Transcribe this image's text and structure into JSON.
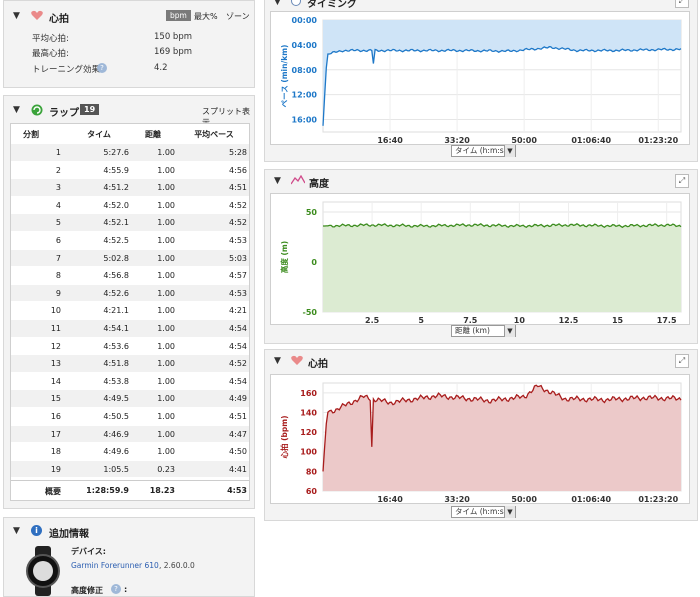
{
  "heart_rate_panel": {
    "title": "心拍",
    "tabs": [
      "bpm",
      "最大%",
      "ゾーン"
    ],
    "rows": [
      {
        "label": "平均心拍:",
        "value": "150 bpm"
      },
      {
        "label": "最高心拍:",
        "value": "169 bpm"
      },
      {
        "label": "トレーニング効果",
        "value": "4.2"
      }
    ]
  },
  "laps_panel": {
    "title": "ラップ",
    "count": "19",
    "split_link": "スプリット表示",
    "headers": [
      "分割",
      "タイム",
      "距離",
      "平均ペース"
    ],
    "rows": [
      [
        "1",
        "5:27.6",
        "1.00",
        "5:28"
      ],
      [
        "2",
        "4:55.9",
        "1.00",
        "4:56"
      ],
      [
        "3",
        "4:51.2",
        "1.00",
        "4:51"
      ],
      [
        "4",
        "4:52.0",
        "1.00",
        "4:52"
      ],
      [
        "5",
        "4:52.1",
        "1.00",
        "4:52"
      ],
      [
        "6",
        "4:52.5",
        "1.00",
        "4:53"
      ],
      [
        "7",
        "5:02.8",
        "1.00",
        "5:03"
      ],
      [
        "8",
        "4:56.8",
        "1.00",
        "4:57"
      ],
      [
        "9",
        "4:52.6",
        "1.00",
        "4:53"
      ],
      [
        "10",
        "4:21.1",
        "1.00",
        "4:21"
      ],
      [
        "11",
        "4:54.1",
        "1.00",
        "4:54"
      ],
      [
        "12",
        "4:53.6",
        "1.00",
        "4:54"
      ],
      [
        "13",
        "4:51.8",
        "1.00",
        "4:52"
      ],
      [
        "14",
        "4:53.8",
        "1.00",
        "4:54"
      ],
      [
        "15",
        "4:49.5",
        "1.00",
        "4:49"
      ],
      [
        "16",
        "4:50.5",
        "1.00",
        "4:51"
      ],
      [
        "17",
        "4:46.9",
        "1.00",
        "4:47"
      ],
      [
        "18",
        "4:49.6",
        "1.00",
        "4:50"
      ],
      [
        "19",
        "1:05.5",
        "0.23",
        "4:41"
      ]
    ],
    "summary": [
      "概要",
      "1:28:59.9",
      "18.23",
      "4:53"
    ]
  },
  "extra_info_panel": {
    "title": "追加情報",
    "device_label": "デバイス:",
    "device_link": "Garmin Forerunner 610",
    "device_version": ", 2.60.0.0",
    "elevation_label": "高度修正"
  },
  "charts": {
    "pace": {
      "title": "タイミング",
      "ylabel": "ペース (min/km)",
      "yticks": [
        "00:00",
        "04:00",
        "08:00",
        "12:00",
        "16:00"
      ],
      "xticks": [
        "16:40",
        "33:20",
        "50:00",
        "01:06:40",
        "01:23:20"
      ],
      "selector": "タイム (h:m:s)"
    },
    "elevation": {
      "title": "高度",
      "ylabel": "高度 (m)",
      "yticks": [
        "50",
        "0",
        "-50"
      ],
      "xticks": [
        "2.5",
        "5",
        "7.5",
        "10",
        "12.5",
        "15",
        "17.5"
      ],
      "selector": "距離 (km)"
    },
    "heart": {
      "title": "心拍",
      "ylabel": "心拍 (bpm)",
      "yticks": [
        "160",
        "140",
        "120",
        "100",
        "80",
        "60"
      ],
      "xticks": [
        "16:40",
        "33:20",
        "50:00",
        "01:06:40",
        "01:23:20"
      ],
      "selector": "タイム (h:m:s)"
    }
  },
  "chart_data": [
    {
      "type": "area",
      "title": "タイミング",
      "ylabel": "ペース (min/km)",
      "x_unit": "seconds",
      "ylim_minutes": [
        0,
        18
      ],
      "y_inverted": true,
      "x": [
        0,
        60,
        300,
        700,
        1200,
        2000,
        2800,
        3400,
        3800,
        4300,
        4800,
        5339
      ],
      "values_minutes": [
        17.0,
        5.5,
        4.9,
        4.9,
        4.9,
        4.9,
        5.0,
        4.4,
        4.9,
        4.9,
        4.8,
        4.7
      ]
    },
    {
      "type": "area",
      "title": "高度",
      "ylabel": "高度 (m)",
      "ylim": [
        -50,
        60
      ],
      "x": [
        0,
        2.5,
        5,
        7.5,
        10,
        12.5,
        15,
        17.5,
        18.23
      ],
      "values": [
        36,
        37,
        36,
        37,
        36,
        37,
        36,
        37,
        36
      ]
    },
    {
      "type": "area",
      "title": "心拍",
      "ylabel": "心拍 (bpm)",
      "ylim": [
        60,
        170
      ],
      "x_unit": "seconds",
      "x": [
        0,
        60,
        200,
        600,
        1000,
        1700,
        2500,
        3000,
        3200,
        3600,
        4200,
        4800,
        5339
      ],
      "values": [
        80,
        140,
        143,
        156,
        150,
        157,
        152,
        156,
        167,
        154,
        153,
        155,
        154
      ]
    }
  ]
}
